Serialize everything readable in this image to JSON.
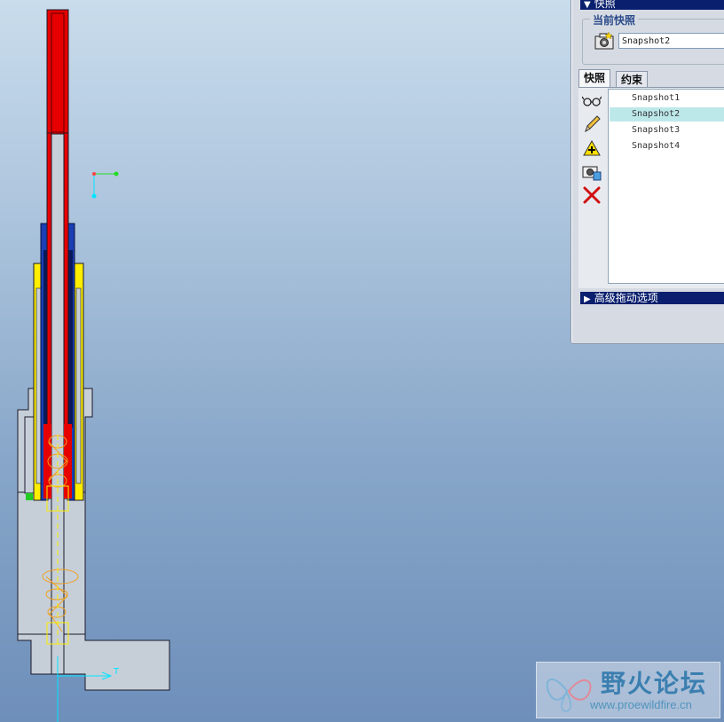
{
  "panel": {
    "title": "快照",
    "current_group_label": "当前快照",
    "current_snapshot_value": "Snapshot2",
    "tabs": [
      {
        "label": "快照",
        "active": true
      },
      {
        "label": "约束",
        "active": false
      }
    ],
    "tools": [
      "glasses-icon",
      "pencil-icon",
      "add-icon",
      "camera-icon",
      "delete-icon"
    ],
    "snapshots": [
      {
        "label": "Snapshot1",
        "selected": false
      },
      {
        "label": "Snapshot2",
        "selected": true
      },
      {
        "label": "Snapshot3",
        "selected": false
      },
      {
        "label": "Snapshot4",
        "selected": false
      }
    ],
    "advanced_section_title": "高级拖动选项",
    "colors": {
      "titlebar": "#0a1f6e",
      "selection": "#bde8ea"
    }
  },
  "viewport": {
    "axis_label": "T",
    "colors": {
      "part_red": "#e60000",
      "part_blue": "#1a3fb4",
      "part_yellow": "#ffee00",
      "part_gray": "#c6cfd8",
      "axis_cyan": "#00e5ff",
      "spring_orange": "#f0a020"
    }
  },
  "watermark": {
    "title": "野火论坛",
    "url": "www.proewildfire.cn"
  }
}
